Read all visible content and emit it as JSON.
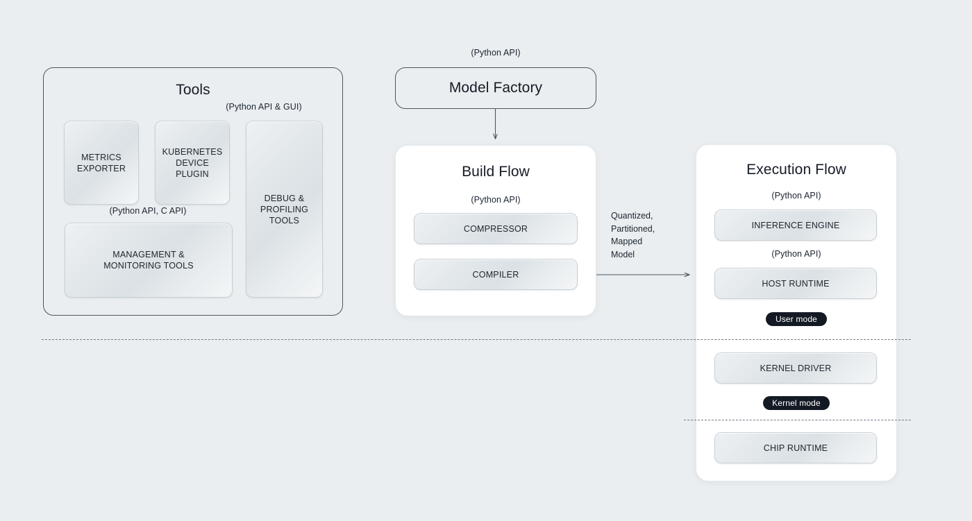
{
  "canvas": {
    "background": "#eaeef0",
    "accent_dark": "#141a24",
    "border": "#4a5560"
  },
  "tools_panel": {
    "title": "Tools",
    "notes": {
      "gui": "(Python API & GUI)",
      "c_api": "(Python API, C API)"
    },
    "boxes": [
      {
        "label": "METRICS\nEXPORTER"
      },
      {
        "label": "KUBERNETES\nDEVICE\nPLUGIN"
      },
      {
        "label": "DEBUG &\nPROFILING\nTOOLS"
      },
      {
        "label": "MANAGEMENT &\nMONITORING TOOLS"
      }
    ]
  },
  "model_factory": {
    "note": "(Python API)",
    "title": "Model Factory"
  },
  "build_flow": {
    "title": "Build Flow",
    "note": "(Python API)",
    "boxes": [
      {
        "label": "COMPRESSOR"
      },
      {
        "label": "COMPILER"
      }
    ]
  },
  "edge": {
    "label": "Quantized,\nPartitioned,\nMapped\nModel"
  },
  "execution_flow": {
    "title": "Execution Flow",
    "notes": {
      "inference": "(Python API)",
      "host": "(Python API)"
    },
    "boxes": [
      {
        "label": "INFERENCE ENGINE"
      },
      {
        "label": "HOST RUNTIME"
      },
      {
        "label": "KERNEL DRIVER"
      },
      {
        "label": "CHIP RUNTIME"
      }
    ],
    "badges": [
      {
        "label": "User mode"
      },
      {
        "label": "Kernel mode"
      }
    ]
  }
}
